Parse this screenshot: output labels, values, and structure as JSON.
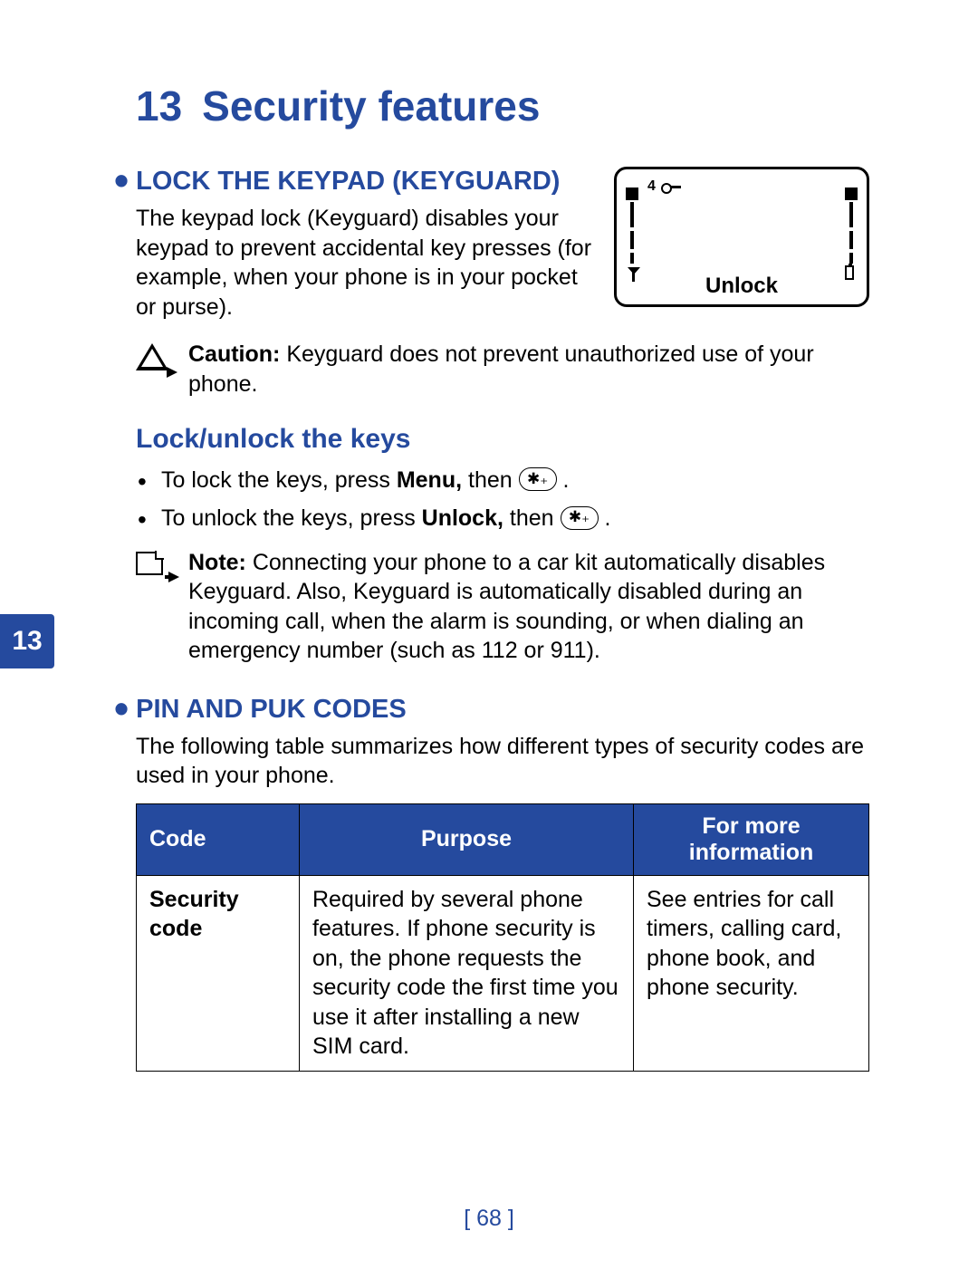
{
  "chapter": {
    "number": "13",
    "title": "Security features"
  },
  "side_tab": "13",
  "section1": {
    "heading": "LOCK THE KEYPAD (KEYGUARD)",
    "body": "The keypad lock (Keyguard) disables your keypad to prevent accidental key presses (for example, when your phone is in your pocket or purse).",
    "phone_signal_label": "4",
    "phone_softkey": "Unlock",
    "caution_label": "Caution:",
    "caution_text": " Keyguard does not prevent unauthorized use of your phone."
  },
  "sub1": {
    "heading": "Lock/unlock the keys",
    "item1_pre": "To lock the keys, press ",
    "item1_bold": "Menu,",
    "item1_post": " then ",
    "item2_pre": "To unlock the keys, press ",
    "item2_bold": "Unlock,",
    "item2_post": " then ",
    "star_glyph": "✱₊",
    "period": " .",
    "note_label": "Note:",
    "note_text": " Connecting your phone to a car kit automatically disables Keyguard. Also, Keyguard is automatically disabled during an incoming call, when the alarm is sounding, or when dialing an emergency number (such as 112 or 911)."
  },
  "section2": {
    "heading": "PIN AND PUK CODES",
    "body": "The following table summarizes how different types of security codes are used in your phone."
  },
  "table": {
    "headers": {
      "code": "Code",
      "purpose": "Purpose",
      "info": "For more information"
    },
    "rows": [
      {
        "code": "Security code",
        "purpose": "Required by several phone features. If phone security is on, the phone requests the security code the first time you use it after installing a new SIM card.",
        "info": "See entries for call timers, calling card, phone book, and phone security."
      }
    ]
  },
  "page_number": "[ 68 ]"
}
